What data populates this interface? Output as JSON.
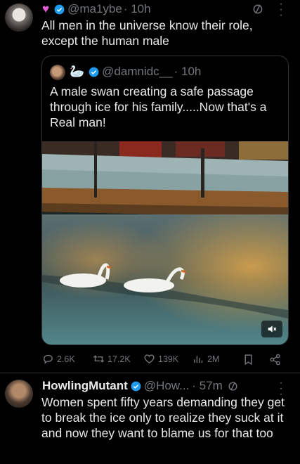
{
  "tweet": {
    "handle": "@ma1ybe",
    "time": "· 10h",
    "text": "All men in the universe know their role, except the human male",
    "quote": {
      "handle": "@damnidc__",
      "time": "· 10h",
      "text": "A male swan creating a safe passage through ice for his family.....Now that's a Real man!"
    },
    "actions": {
      "replies": "2.6K",
      "reposts": "17.2K",
      "likes": "139K",
      "views": "2M"
    }
  },
  "reply": {
    "name": "HowlingMutant",
    "handle": "@How...",
    "time": "· 57m",
    "text": "Women spent fifty years demanding they get to break the ice only to realize they suck at it and now they want to blame us for that too"
  },
  "colors": {
    "background": "#000000",
    "text": "#e7e9ea",
    "muted": "#71767b",
    "verified": "#1d9bf0",
    "heart": "#e05dd6",
    "border": "#2f3336"
  },
  "icons": [
    "pink-heart-icon",
    "verified-badge-icon",
    "slash-circle-icon",
    "more-vertical-icon",
    "swan-emoji-icon",
    "reply-icon",
    "repost-icon",
    "like-icon",
    "views-icon",
    "bookmark-icon",
    "share-icon",
    "mute-icon"
  ]
}
